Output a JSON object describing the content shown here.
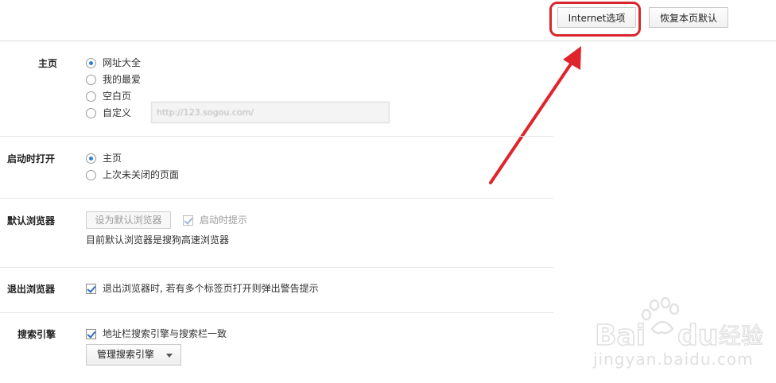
{
  "toolbar": {
    "internet_options_label": "Internet选项",
    "restore_defaults_label": "恢复本页默认"
  },
  "homepage": {
    "label": "主页",
    "options": [
      "网址大全",
      "我的最爱",
      "空白页",
      "自定义"
    ],
    "selected": "网址大全",
    "custom_url_placeholder": "http://123.sogou.com/"
  },
  "startup": {
    "label": "启动时打开",
    "options": [
      "主页",
      "上次未关闭的页面"
    ],
    "selected": "主页"
  },
  "default_browser": {
    "label": "默认浏览器",
    "set_default_button": "设为默认浏览器",
    "prompt_on_start_label": "启动时提示",
    "status_text": "目前默认浏览器是搜狗高速浏览器"
  },
  "exit_browser": {
    "label": "退出浏览器",
    "warn_label": "退出浏览器时, 若有多个标签页打开则弹出警告提示"
  },
  "search_engine": {
    "label": "搜索引擎",
    "sync_label": "地址栏搜索引擎与搜索栏一致",
    "manage_label": "管理搜索引擎"
  },
  "annotation": {
    "highlight_color": "#d9262c"
  },
  "watermark": {
    "brand": "Baidu经验",
    "url": "jingyan.baidu.com"
  }
}
